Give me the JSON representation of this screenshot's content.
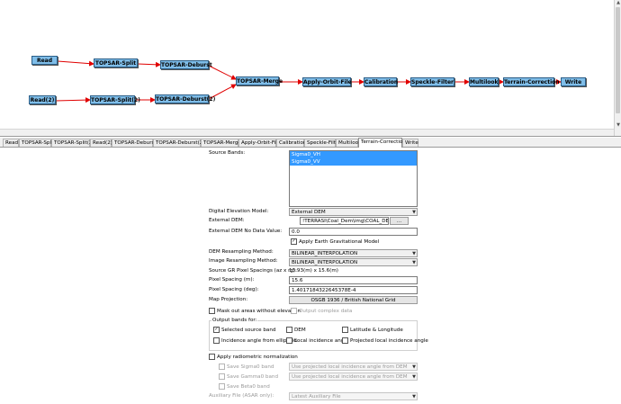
{
  "graph": {
    "nodes": {
      "read": "Read",
      "read2": "Read(2)",
      "split": "TOPSAR-Split",
      "split2": "TOPSAR-Split(2)",
      "deburst": "TOPSAR-Deburst",
      "deburst2": "TOPSAR-Deburst(2)",
      "merge": "TOPSAR-Merge",
      "orbit": "Apply-Orbit-File",
      "calibration": "Calibration",
      "speckle": "Speckle-Filter",
      "multilook": "Multilook",
      "terrain": "Terrain-Correction",
      "write": "Write"
    }
  },
  "tabs": [
    "Read",
    "TOPSAR-Split",
    "TOPSAR-Split(2)",
    "Read(2)",
    "TOPSAR-Deburst",
    "TOPSAR-Deburst(2)",
    "TOPSAR-Merge",
    "Apply-Orbit-File",
    "Calibration",
    "Speckle-Filter",
    "Multilook",
    "Terrain-Correction",
    "Write"
  ],
  "active_tab": "Terrain-Correction",
  "form": {
    "source_bands_label": "Source Bands:",
    "source_bands": [
      "Sigma0_VH",
      "Sigma0_VV"
    ],
    "dem_label": "Digital Elevation Model:",
    "dem_value": "External DEM",
    "ext_dem_label": "External DEM:",
    "ext_dem_value": "!TERRASI\\Coal_Dem\\img\\COAL_DEM.tif",
    "browse_label": "...",
    "nodata_label": "External DEM No Data Value:",
    "nodata_value": "0.0",
    "egm_label": "Apply Earth Gravitational Model",
    "dem_resamp_label": "DEM Resampling Method:",
    "dem_resamp_value": "BILINEAR_INTERPOLATION",
    "img_resamp_label": "Image Resampling Method:",
    "img_resamp_value": "BILINEAR_INTERPOLATION",
    "src_spacing_label": "Source GR Pixel Spacings (az x rg):",
    "src_spacing_value": "13.93(m) x 15.6(m)",
    "px_m_label": "Pixel Spacing (m):",
    "px_m_value": "15.6",
    "px_deg_label": "Pixel Spacing (deg):",
    "px_deg_value": "1.4017184322645378E-4",
    "proj_label": "Map Projection:",
    "proj_value": "OSGB 1936 / British National Grid",
    "mask_label": "Mask out areas without elevation",
    "complex_label": "Output complex data",
    "output_bands_label": "Output bands for:",
    "sel_src_label": "Selected source band",
    "dem_out_label": "DEM",
    "latlon_label": "Latitude & Longitude",
    "inc_ell_label": "Incidence angle from ellipsoid",
    "local_inc_label": "Local incidence angle",
    "proj_local_label": "Projected local incidence angle",
    "radio_norm_label": "Apply radiometric normalization",
    "save_sigma_label": "Save Sigma0 band",
    "save_gamma_label": "Save Gamma0 band",
    "save_beta_label": "Save Beta0 band",
    "use_proj_value": "Use projected local incidence angle from DEM",
    "aux_label": "Auxiliary File (ASAR only):",
    "aux_value": "Latest Auxiliary File"
  }
}
